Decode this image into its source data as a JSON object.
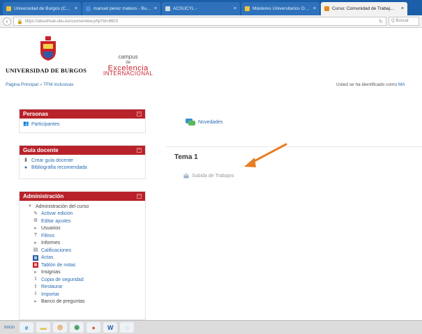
{
  "browser": {
    "tabs": [
      {
        "label": "Universidad de Burgos (Cont...",
        "icon": "ubu-favicon-icon",
        "active": false,
        "color": "#f0c23a"
      },
      {
        "label": "manuel perez mateos - Busca...",
        "icon": "search-favicon-icon",
        "active": false,
        "color": "#4a8fe0"
      },
      {
        "label": "ACSUCYL -",
        "icon": "page-favicon-icon",
        "active": false,
        "color": "#cfd9e6"
      },
      {
        "label": "Másteres Universitarios Oficia...",
        "icon": "ubu-favicon-icon",
        "active": false,
        "color": "#f0c23a"
      },
      {
        "label": "Curso: Comunidad de Trabaj...",
        "icon": "moodle-favicon-icon",
        "active": true,
        "color": "#e58a1f"
      }
    ],
    "url": "https://ubuvirtual.ubu.es/course/view.php?id=8603",
    "search_placeholder": "Q Buscar"
  },
  "header": {
    "university": "UNIVERSIDAD DE BURGOS",
    "campus_line1": "campus",
    "campus_line2": "de",
    "campus_line3": "Excelencia",
    "campus_line4": "INTERNACIONAL"
  },
  "breadcrumb": {
    "home": "Página Principal",
    "separator": "»",
    "course": "TFM inclusivas"
  },
  "login": {
    "prefix": "Usted se ha identificado como",
    "user": "MA"
  },
  "blocks": {
    "personas": {
      "title": "Personas",
      "items": [
        {
          "label": "Participantes",
          "icon": "participants-icon"
        }
      ]
    },
    "guia": {
      "title": "Guía docente",
      "items": [
        {
          "label": "Crear guía docente",
          "icon": "document-icon"
        },
        {
          "label": "Bibliografía recomendada",
          "icon": "globe-icon"
        }
      ]
    },
    "admin": {
      "title": "Administración",
      "root": "Administración del curso",
      "items": [
        {
          "label": "Activar edición",
          "icon": "pencil-icon",
          "type": "link"
        },
        {
          "label": "Editar ajustes",
          "icon": "gear-icon",
          "type": "link"
        },
        {
          "label": "Usuarios",
          "icon": "expand-arrow-icon",
          "type": "folder"
        },
        {
          "label": "Filtros",
          "icon": "filter-icon",
          "type": "link"
        },
        {
          "label": "Informes",
          "icon": "expand-arrow-icon",
          "type": "folder"
        },
        {
          "label": "Calificaciones",
          "icon": "grades-icon",
          "type": "link"
        },
        {
          "label": "Actas",
          "icon": "actas-icon",
          "type": "link"
        },
        {
          "label": "Tablón de notas",
          "icon": "noticeboard-icon",
          "type": "link"
        },
        {
          "label": "Insignias",
          "icon": "expand-arrow-icon",
          "type": "folder"
        },
        {
          "label": "Copia de seguridad",
          "icon": "backup-icon",
          "type": "link"
        },
        {
          "label": "Restaurar",
          "icon": "restore-icon",
          "type": "link"
        },
        {
          "label": "Importar",
          "icon": "import-icon",
          "type": "link"
        },
        {
          "label": "Banco de preguntas",
          "icon": "expand-arrow-icon",
          "type": "folder"
        }
      ]
    }
  },
  "main": {
    "news": "Novedades",
    "section_title": "Tema 1",
    "assignment": "Subida de Trabajos"
  },
  "taskbar": {
    "start_label": "Inicio",
    "apps": [
      {
        "name": "ie-taskbar-icon",
        "glyph": "e",
        "color": "#3b8fd6"
      },
      {
        "name": "folder-taskbar-icon",
        "glyph": "▬",
        "color": "#e6c251"
      },
      {
        "name": "media-taskbar-icon",
        "glyph": "◎",
        "color": "#e58a1f"
      },
      {
        "name": "chrome-taskbar-icon",
        "glyph": "◉",
        "color": "#3a9d5d"
      },
      {
        "name": "firefox-taskbar-icon",
        "glyph": "●",
        "color": "#d9602a"
      },
      {
        "name": "word-taskbar-icon",
        "glyph": "W",
        "color": "#2b5aa8"
      },
      {
        "name": "settings-taskbar-icon",
        "glyph": "◌",
        "color": "#4a7fc2"
      }
    ]
  }
}
